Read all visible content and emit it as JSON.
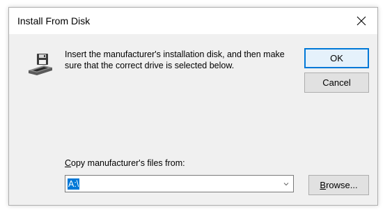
{
  "dialog": {
    "title": "Install From Disk",
    "close_glyph": "✕",
    "message": "Insert the manufacturer's installation disk, and then make sure that the correct drive is selected below.",
    "icon": "floppy-drive-icon"
  },
  "buttons": {
    "ok": "OK",
    "cancel": "Cancel",
    "browse_mnemonic": "B",
    "browse_rest": "rowse..."
  },
  "copy_from": {
    "label_mnemonic": "C",
    "label_rest": "opy manufacturer's files from:",
    "value": "A:\\"
  },
  "colors": {
    "accent": "#0078d7",
    "dialog_bg": "#f0f0f0"
  }
}
